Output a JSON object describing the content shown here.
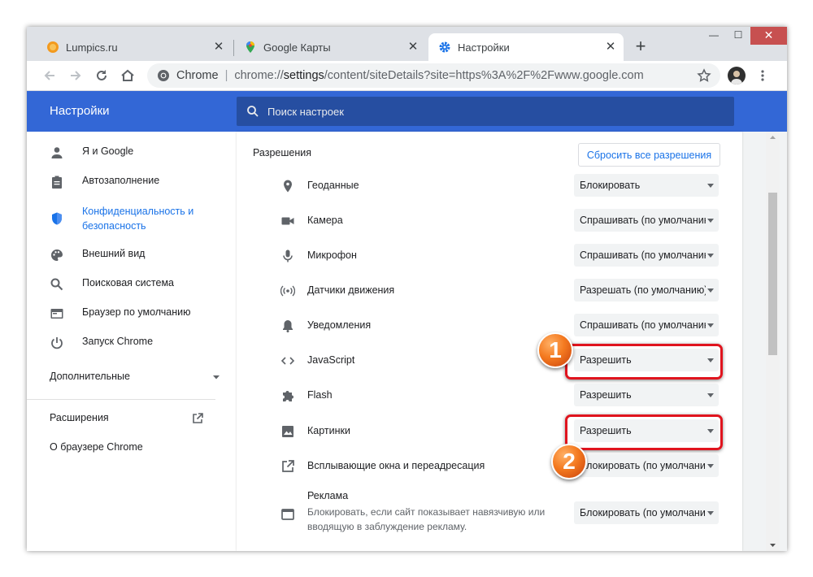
{
  "tabs": [
    {
      "title": "Lumpics.ru",
      "icon": "orange-icon"
    },
    {
      "title": "Google Карты",
      "icon": "maps-icon"
    },
    {
      "title": "Настройки",
      "icon": "gear-icon"
    }
  ],
  "omnibox": {
    "site_label": "Chrome",
    "url_prefix": "chrome://",
    "url_path": "settings",
    "url_rest": "/content/siteDetails?site=https%3A%2F%2Fwww.google.com"
  },
  "header": {
    "title": "Настройки",
    "search_placeholder": "Поиск настроек"
  },
  "sidebar": {
    "items": [
      {
        "label": "Я и Google",
        "icon": "person-icon"
      },
      {
        "label": "Автозаполнение",
        "icon": "clipboard-icon"
      },
      {
        "label": "Конфиденциальность и безопасность",
        "icon": "shield-icon"
      },
      {
        "label": "Внешний вид",
        "icon": "palette-icon"
      },
      {
        "label": "Поисковая система",
        "icon": "search-icon"
      },
      {
        "label": "Браузер по умолчанию",
        "icon": "browser-icon"
      },
      {
        "label": "Запуск Chrome",
        "icon": "power-icon"
      }
    ],
    "advanced_label": "Дополнительные",
    "extensions_label": "Расширения",
    "about_label": "О браузере Chrome"
  },
  "permissions": {
    "heading": "Разрешения",
    "reset_label": "Сбросить все разрешения",
    "rows": [
      {
        "label": "Геоданные",
        "value": "Блокировать",
        "icon": "location-icon"
      },
      {
        "label": "Камера",
        "value": "Спрашивать (по умолчанию)",
        "icon": "camera-icon"
      },
      {
        "label": "Микрофон",
        "value": "Спрашивать (по умолчанию)",
        "icon": "microphone-icon"
      },
      {
        "label": "Датчики движения",
        "value": "Разрешать (по умолчанию)",
        "icon": "motion-sensor-icon"
      },
      {
        "label": "Уведомления",
        "value": "Спрашивать (по умолчанию)",
        "icon": "bell-icon"
      },
      {
        "label": "JavaScript",
        "value": "Разрешить",
        "icon": "code-icon"
      },
      {
        "label": "Flash",
        "value": "Разрешить",
        "icon": "puzzle-icon"
      },
      {
        "label": "Картинки",
        "value": "Разрешить",
        "icon": "image-icon"
      },
      {
        "label": "Всплывающие окна и переадресация",
        "value": "Блокировать (по умолчанию)",
        "icon": "external-window-icon"
      }
    ],
    "ads": {
      "label": "Реклама",
      "description": "Блокировать, если сайт показывает навязчивую или вводящую в заблуждение рекламу.",
      "value": "Блокировать (по умолчанию)",
      "icon": "ads-window-icon"
    }
  },
  "annotations": {
    "badge_1": "1",
    "badge_2": "2",
    "highlight_color": "#e0141e",
    "badge_color": "#f47a20"
  },
  "colors": {
    "header_blue": "#3367d6",
    "search_blue": "#264ea1",
    "accent": "#1a73e8"
  }
}
